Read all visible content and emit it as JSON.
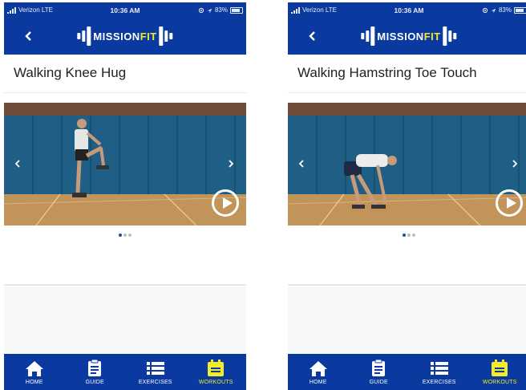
{
  "colors": {
    "brand_blue": "#0a3aa0",
    "accent_yellow": "#f2ea2b",
    "text_dark": "#222222"
  },
  "screens": [
    {
      "status": {
        "carrier": "Verizon  LTE",
        "time": "10:36 AM",
        "battery": "83%"
      },
      "logo": {
        "text_main": "MISSION",
        "text_accent": "FIT"
      },
      "title": "Walking Knee Hug",
      "icons": {
        "back": "chevron-left-icon",
        "prev": "chevron-left-icon",
        "next": "chevron-right-icon",
        "play": "play-icon"
      },
      "carousel": {
        "pages": 3,
        "active": 0
      },
      "tabs": [
        {
          "label": "HOME",
          "icon": "home-icon",
          "active": false
        },
        {
          "label": "GUIDE",
          "icon": "clipboard-icon",
          "active": false
        },
        {
          "label": "EXERCISES",
          "icon": "list-icon",
          "active": false
        },
        {
          "label": "WORKOUTS",
          "icon": "calendar-icon",
          "active": true
        }
      ]
    },
    {
      "status": {
        "carrier": "Verizon  LTE",
        "time": "10:36 AM",
        "battery": "83%"
      },
      "logo": {
        "text_main": "MISSION",
        "text_accent": "FIT"
      },
      "title": "Walking Hamstring Toe Touch",
      "icons": {
        "back": "chevron-left-icon",
        "prev": "chevron-left-icon",
        "next": "chevron-right-icon",
        "play": "play-icon"
      },
      "carousel": {
        "pages": 3,
        "active": 0
      },
      "tabs": [
        {
          "label": "HOME",
          "icon": "home-icon",
          "active": false
        },
        {
          "label": "GUIDE",
          "icon": "clipboard-icon",
          "active": false
        },
        {
          "label": "EXERCISES",
          "icon": "list-icon",
          "active": false
        },
        {
          "label": "WORKOUTS",
          "icon": "calendar-icon",
          "active": true
        }
      ]
    }
  ]
}
